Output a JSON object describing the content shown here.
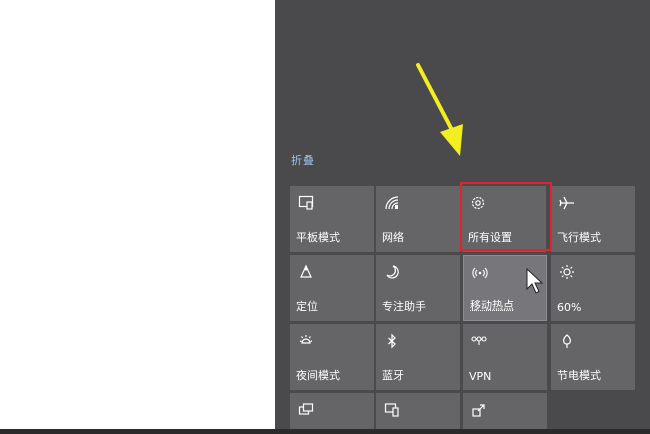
{
  "action_center": {
    "collapse_label": "折叠",
    "tiles": [
      {
        "label": "平板模式",
        "icon": "tablet-mode-icon"
      },
      {
        "label": "网络",
        "icon": "network-icon"
      },
      {
        "label": "所有设置",
        "icon": "gear-icon"
      },
      {
        "label": "飞行模式",
        "icon": "airplane-icon"
      },
      {
        "label": "定位",
        "icon": "location-icon"
      },
      {
        "label": "专注助手",
        "icon": "moon-icon"
      },
      {
        "label": "移动热点",
        "icon": "hotspot-icon"
      },
      {
        "label": "60%",
        "icon": "brightness-icon"
      },
      {
        "label": "夜间模式",
        "icon": "night-light-icon"
      },
      {
        "label": "蓝牙",
        "icon": "bluetooth-icon"
      },
      {
        "label": "VPN",
        "icon": "vpn-icon"
      },
      {
        "label": "节电模式",
        "icon": "battery-saver-icon"
      },
      {
        "label": "",
        "icon": "project-icon"
      },
      {
        "label": "",
        "icon": "connect-icon"
      },
      {
        "label": "",
        "icon": "nearby-sharing-icon"
      }
    ]
  },
  "colors": {
    "panel_bg": "#4a494b",
    "tile_bg": "#656467",
    "tile_active_bg": "#77767a",
    "link": "#9ec3ef",
    "highlight": "#e4232f",
    "arrow": "#f2ee1f"
  }
}
